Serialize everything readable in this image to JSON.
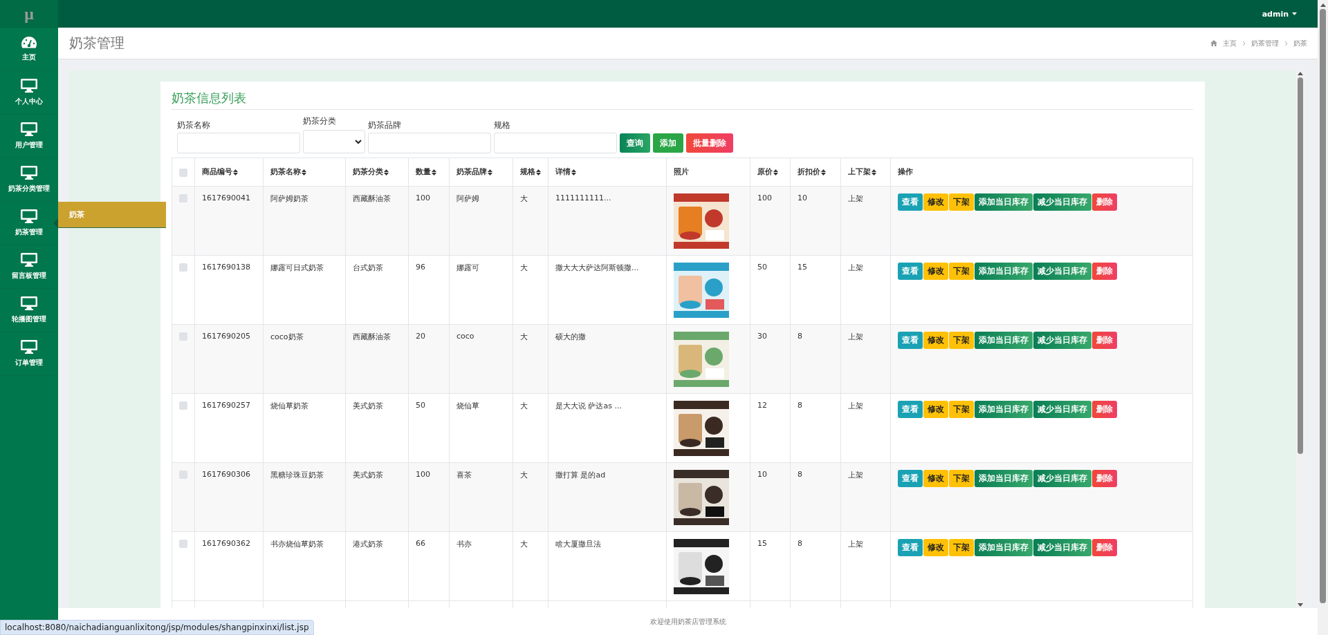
{
  "logo": "μ",
  "sidebar": {
    "items": [
      {
        "label": "主页",
        "kind": "dashboard",
        "selected": false
      },
      {
        "label": "个人中心",
        "kind": "page",
        "selected": false
      },
      {
        "label": "用户管理",
        "kind": "page",
        "selected": false
      },
      {
        "label": "奶茶分类管理",
        "kind": "page",
        "selected": false
      },
      {
        "label": "奶茶管理",
        "kind": "page",
        "selected": true
      },
      {
        "label": "留言板管理",
        "kind": "page",
        "selected": false
      },
      {
        "label": "轮播图管理",
        "kind": "page",
        "selected": false
      },
      {
        "label": "订单管理",
        "kind": "page",
        "selected": false
      }
    ],
    "submenu": [
      {
        "label": "奶茶"
      }
    ]
  },
  "topbar": {
    "user": "admin"
  },
  "header": {
    "title": "奶茶管理",
    "breadcrumb": [
      "主页",
      "奶茶管理",
      "奶茶"
    ]
  },
  "card": {
    "title": "奶茶信息列表",
    "filters": [
      {
        "kind": "input",
        "label": "奶茶名称"
      },
      {
        "kind": "select",
        "label": "奶茶分类"
      },
      {
        "kind": "input",
        "label": "奶茶品牌"
      },
      {
        "kind": "input",
        "label": "规格"
      }
    ],
    "buttons": [
      {
        "label": "查询",
        "kind": "search"
      },
      {
        "label": "添加",
        "kind": "add"
      },
      {
        "label": "批量删除",
        "kind": "delete"
      }
    ],
    "table": {
      "select_all": {
        "checked": false
      },
      "columns": [
        {
          "label": "商品编号",
          "sortable": true
        },
        {
          "label": "奶茶名称",
          "sortable": true
        },
        {
          "label": "奶茶分类",
          "sortable": true
        },
        {
          "label": "数量",
          "sortable": true
        },
        {
          "label": "奶茶品牌",
          "sortable": true
        },
        {
          "label": "规格",
          "sortable": true
        },
        {
          "label": "详情",
          "sortable": true
        },
        {
          "label": "照片",
          "sortable": false
        },
        {
          "label": "原价",
          "sortable": true
        },
        {
          "label": "折扣价",
          "sortable": true
        },
        {
          "label": "上下架",
          "sortable": true
        },
        {
          "label": "操作",
          "sortable": false
        }
      ],
      "rows": [
        {
          "checked": false,
          "cells": [
            "1617690041",
            "阿萨姆奶茶",
            "西藏酥油茶",
            "100",
            "阿萨姆",
            "大",
            "1111111111..."
          ],
          "photo": {
            "kind": "picture"
          },
          "tail": [
            "100",
            "10",
            "上架"
          ],
          "actions": [
            {
              "label": "查看",
              "kind": "view"
            },
            {
              "label": "修改",
              "kind": "edit"
            },
            {
              "label": "下架",
              "kind": "edit"
            },
            {
              "label": "添加当日库存",
              "kind": "stock"
            },
            {
              "label": "减少当日库存",
              "kind": "stock"
            },
            {
              "label": "删除",
              "kind": "delete"
            }
          ]
        },
        {
          "checked": false,
          "cells": [
            "1617690138",
            "娜露可日式奶茶",
            "台式奶茶",
            "96",
            "娜露可",
            "大",
            "撒大大大萨达阿斯顿撒..."
          ],
          "photo": {
            "kind": "picture"
          },
          "tail": [
            "50",
            "15",
            "上架"
          ],
          "actions": [
            {
              "label": "查看",
              "kind": "view"
            },
            {
              "label": "修改",
              "kind": "edit"
            },
            {
              "label": "下架",
              "kind": "edit"
            },
            {
              "label": "添加当日库存",
              "kind": "stock"
            },
            {
              "label": "减少当日库存",
              "kind": "stock"
            },
            {
              "label": "删除",
              "kind": "delete"
            }
          ]
        },
        {
          "checked": false,
          "cells": [
            "1617690205",
            "coco奶茶",
            "西藏酥油茶",
            "20",
            "coco",
            "大",
            "硕大的撒"
          ],
          "photo": {
            "kind": "picture"
          },
          "tail": [
            "30",
            "8",
            "上架"
          ],
          "actions": [
            {
              "label": "查看",
              "kind": "view"
            },
            {
              "label": "修改",
              "kind": "edit"
            },
            {
              "label": "下架",
              "kind": "edit"
            },
            {
              "label": "添加当日库存",
              "kind": "stock"
            },
            {
              "label": "减少当日库存",
              "kind": "stock"
            },
            {
              "label": "删除",
              "kind": "delete"
            }
          ]
        },
        {
          "checked": false,
          "cells": [
            "1617690257",
            "烧仙草奶茶",
            "美式奶茶",
            "50",
            "烧仙草",
            "大",
            "是大大说 萨达as ..."
          ],
          "photo": {
            "kind": "picture"
          },
          "tail": [
            "12",
            "8",
            "上架"
          ],
          "actions": [
            {
              "label": "查看",
              "kind": "view"
            },
            {
              "label": "修改",
              "kind": "edit"
            },
            {
              "label": "下架",
              "kind": "edit"
            },
            {
              "label": "添加当日库存",
              "kind": "stock"
            },
            {
              "label": "减少当日库存",
              "kind": "stock"
            },
            {
              "label": "删除",
              "kind": "delete"
            }
          ]
        },
        {
          "checked": false,
          "cells": [
            "1617690306",
            "黑糖珍珠豆奶茶",
            "美式奶茶",
            "100",
            "喜茶",
            "大",
            "撒打算 是的ad"
          ],
          "photo": {
            "kind": "picture"
          },
          "tail": [
            "10",
            "8",
            "上架"
          ],
          "actions": [
            {
              "label": "查看",
              "kind": "view"
            },
            {
              "label": "修改",
              "kind": "edit"
            },
            {
              "label": "下架",
              "kind": "edit"
            },
            {
              "label": "添加当日库存",
              "kind": "stock"
            },
            {
              "label": "减少当日库存",
              "kind": "stock"
            },
            {
              "label": "删除",
              "kind": "delete"
            }
          ]
        },
        {
          "checked": false,
          "cells": [
            "1617690362",
            "书亦烧仙草奶茶",
            "港式奶茶",
            "66",
            "书亦",
            "大",
            "啥大厦撒旦法"
          ],
          "photo": {
            "kind": "picture"
          },
          "tail": [
            "15",
            "8",
            "上架"
          ],
          "actions": [
            {
              "label": "查看",
              "kind": "view"
            },
            {
              "label": "修改",
              "kind": "edit"
            },
            {
              "label": "下架",
              "kind": "edit"
            },
            {
              "label": "添加当日库存",
              "kind": "stock"
            },
            {
              "label": "减少当日库存",
              "kind": "stock"
            },
            {
              "label": "删除",
              "kind": "delete"
            }
          ]
        }
      ]
    }
  },
  "footer": {
    "text": "欢迎使用奶茶店管理系统"
  },
  "status_url": "localhost:8080/naichadianguanlixitong/jsp/modules/shangpinxinxi/list.jsp"
}
